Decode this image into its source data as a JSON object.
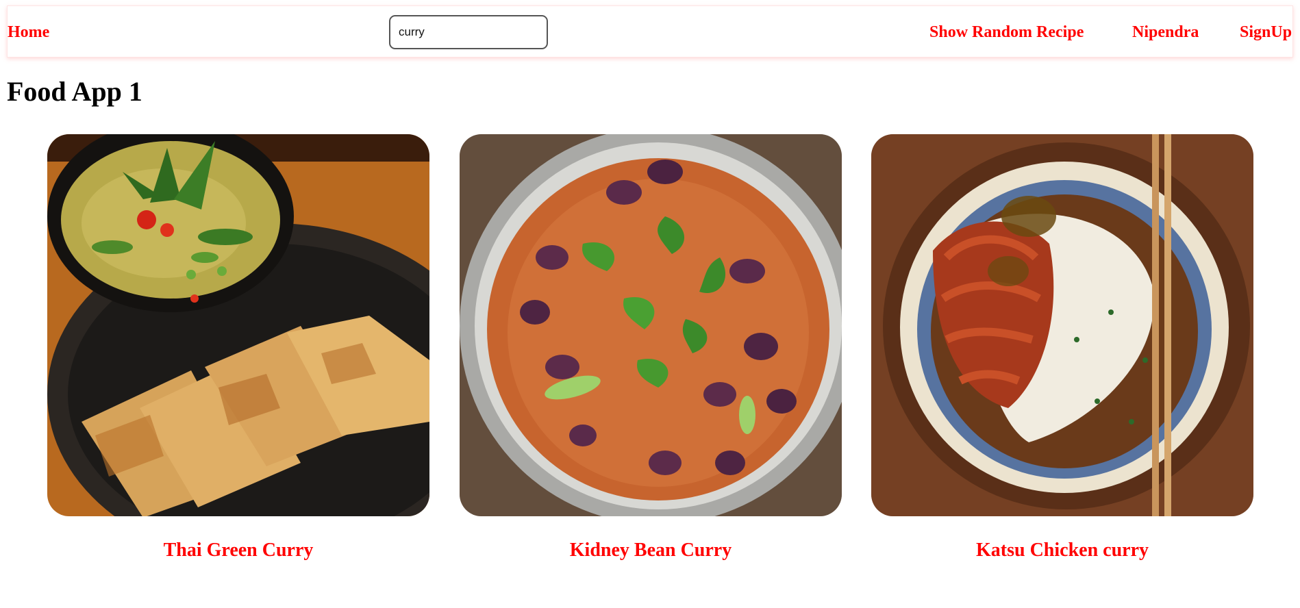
{
  "navbar": {
    "home_label": "Home",
    "search": {
      "value": "curry",
      "placeholder": ""
    },
    "random_recipe_label": "Show Random Recipe",
    "user_label": "Nipendra",
    "signup_label": "SignUp"
  },
  "page": {
    "title": "Food App 1"
  },
  "recipes": [
    {
      "title": "Thai Green Curry",
      "image_icon": "thai-green-curry-photo"
    },
    {
      "title": "Kidney Bean Curry",
      "image_icon": "kidney-bean-curry-photo"
    },
    {
      "title": "Katsu Chicken curry",
      "image_icon": "katsu-chicken-curry-photo"
    }
  ],
  "colors": {
    "link": "#ff0000",
    "title": "#000000",
    "nav_shadow": "#ff8c8c"
  }
}
